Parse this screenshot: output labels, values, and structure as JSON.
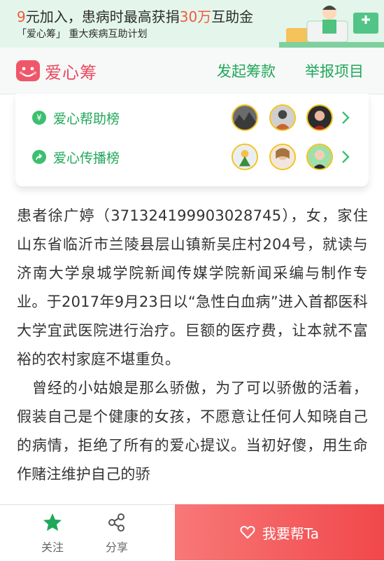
{
  "banner": {
    "line1_pre": "9",
    "line1_mid": "元加入，患病时最高获捐",
    "line1_num": "30万",
    "line1_post": "互助金",
    "line2": "「爱心筹」 重大疾病互助计划"
  },
  "header": {
    "logo_text": "爱心筹",
    "nav_start": "发起筹款",
    "nav_report": "举报项目"
  },
  "ranks": [
    {
      "icon": "yen-icon",
      "label": "爱心帮助榜"
    },
    {
      "icon": "share-arrow-icon",
      "label": "爱心传播榜"
    }
  ],
  "story": {
    "p1": "患者徐广婷（371324199903028745），女，家住山东省临沂市兰陵县层山镇新吴庄村204号，就读与济南大学泉城学院新闻传媒学院新闻采编与制作专业。于2017年9月23日以“急性白血病”进入首都医科大学宜武医院进行治疗。巨额的医疗费，让本就不富裕的农村家庭不堪重负。",
    "p2": "曾经的小姑娘是那么骄傲，为了可以骄傲的活着，假装自己是个健康的女孩，不愿意让任何人知晓自己的病情，拒绝了所有的爱心提议。当初好傻，用生命作赌注维护自己的骄"
  },
  "bottom": {
    "follow_label": "关注",
    "share_label": "分享",
    "help_label": "我要帮Ta"
  },
  "colors": {
    "accent_green": "#1fa85a",
    "brand_pink": "#e84a5f",
    "help_red": "#f1484a",
    "avatar_border": "#f4c21b"
  }
}
